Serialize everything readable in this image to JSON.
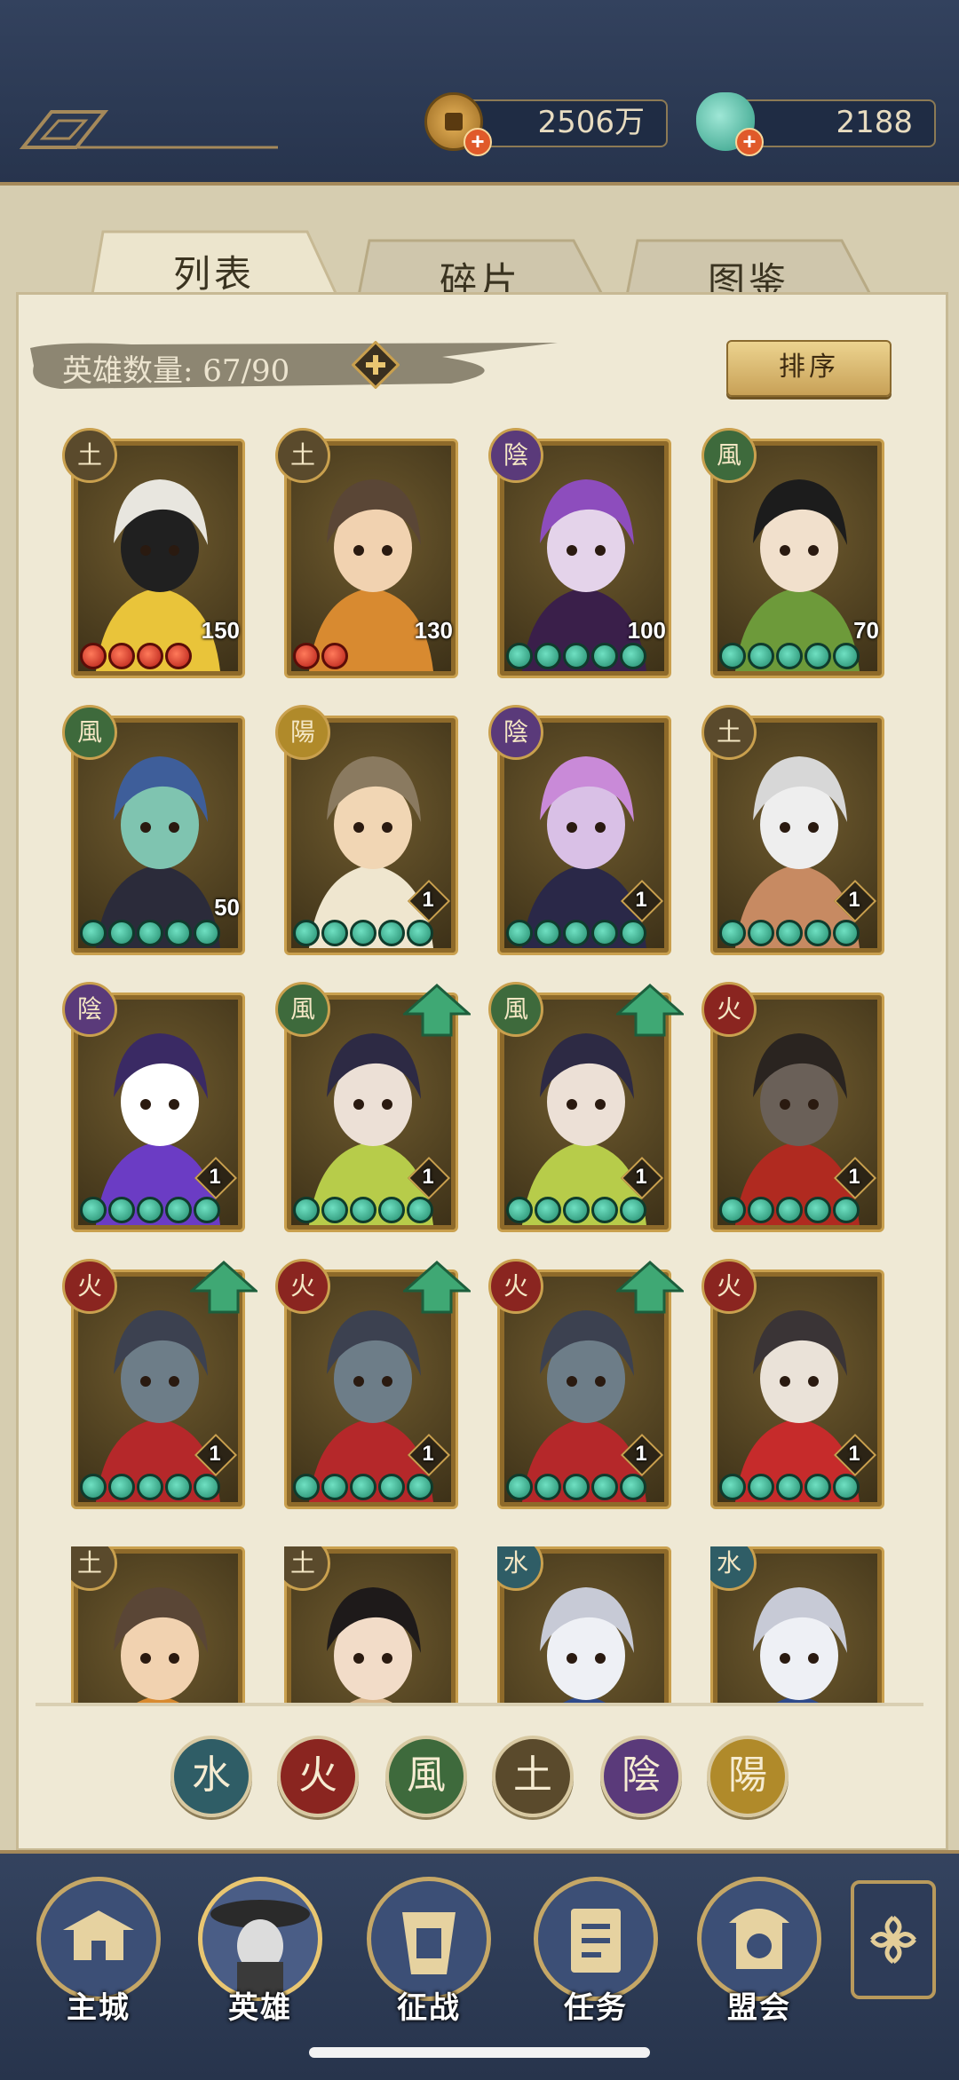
{
  "currency": {
    "coins": "2506万",
    "jade": "2188"
  },
  "tabs": [
    {
      "label": "列表"
    },
    {
      "label": "碎片"
    },
    {
      "label": "图鉴"
    }
  ],
  "hero_count": "英雄数量:  67/90",
  "sort_label": "排序",
  "element_colors": {
    "earth": "#5a4a2c",
    "yin": "#5a3a7a",
    "wind": "#3e6a3c",
    "yang": "#b08a2a",
    "fire": "#8a2520",
    "water": "#2f5d66"
  },
  "heroes": [
    {
      "element": "土",
      "level": "150",
      "stars": 4,
      "star_color": "red",
      "upgrade": false,
      "portrait": "white-hair-girl"
    },
    {
      "element": "土",
      "level": "130",
      "stars": 2,
      "star_color": "red",
      "upgrade": false,
      "portrait": "brown-hair-boy"
    },
    {
      "element": "陰",
      "level": "100",
      "stars": 5,
      "star_color": "green",
      "upgrade": false,
      "portrait": "purple-spider-lady"
    },
    {
      "element": "風",
      "level": "70",
      "stars": 5,
      "star_color": "green",
      "upgrade": false,
      "portrait": "black-hair-lady"
    },
    {
      "element": "風",
      "level": "50",
      "stars": 5,
      "star_color": "green",
      "upgrade": false,
      "portrait": "blue-hat-girl"
    },
    {
      "element": "陽",
      "level": "1",
      "stars": 5,
      "star_color": "green",
      "upgrade": false,
      "portrait": "cloak-youth"
    },
    {
      "element": "陰",
      "level": "1",
      "stars": 5,
      "star_color": "green",
      "upgrade": false,
      "portrait": "pink-hair-woman"
    },
    {
      "element": "土",
      "level": "1",
      "stars": 5,
      "star_color": "green",
      "upgrade": false,
      "portrait": "white-beard-old-man"
    },
    {
      "element": "陰",
      "level": "1",
      "stars": 5,
      "star_color": "green",
      "upgrade": false,
      "portrait": "masked-purple-ninja"
    },
    {
      "element": "風",
      "level": "1",
      "stars": 5,
      "star_color": "green",
      "upgrade": true,
      "portrait": "twin-tail-girl"
    },
    {
      "element": "風",
      "level": "1",
      "stars": 5,
      "star_color": "green",
      "upgrade": true,
      "portrait": "twin-tail-girl"
    },
    {
      "element": "火",
      "level": "1",
      "stars": 5,
      "star_color": "green",
      "upgrade": false,
      "portrait": "straw-hat-ronin"
    },
    {
      "element": "火",
      "level": "1",
      "stars": 5,
      "star_color": "green",
      "upgrade": true,
      "portrait": "long-beard-warrior"
    },
    {
      "element": "火",
      "level": "1",
      "stars": 5,
      "star_color": "green",
      "upgrade": true,
      "portrait": "long-beard-warrior"
    },
    {
      "element": "火",
      "level": "1",
      "stars": 5,
      "star_color": "green",
      "upgrade": true,
      "portrait": "long-beard-warrior"
    },
    {
      "element": "火",
      "level": "1",
      "stars": 5,
      "star_color": "green",
      "upgrade": false,
      "portrait": "red-armor-noble"
    },
    {
      "element": "土",
      "level": "",
      "stars": 0,
      "star_color": "green",
      "upgrade": false,
      "portrait": "brown-hair-boy"
    },
    {
      "element": "土",
      "level": "",
      "stars": 0,
      "star_color": "green",
      "upgrade": false,
      "portrait": "horned-girl"
    },
    {
      "element": "水",
      "level": "",
      "stars": 0,
      "star_color": "green",
      "upgrade": false,
      "portrait": "silver-hair-man"
    },
    {
      "element": "水",
      "level": "",
      "stars": 0,
      "star_color": "green",
      "upgrade": false,
      "portrait": "silver-hair-man"
    }
  ],
  "filters": [
    {
      "glyph": "水",
      "color": "#2f5d66"
    },
    {
      "glyph": "火",
      "color": "#8a2520"
    },
    {
      "glyph": "風",
      "color": "#3e6a3c"
    },
    {
      "glyph": "土",
      "color": "#5a4a2c"
    },
    {
      "glyph": "陰",
      "color": "#5a3a7a"
    },
    {
      "glyph": "陽",
      "color": "#b08a2a"
    }
  ],
  "nav": [
    {
      "label": "主城",
      "icon": "castle-icon"
    },
    {
      "label": "英雄",
      "icon": "hero-icon"
    },
    {
      "label": "征战",
      "icon": "battle-icon"
    },
    {
      "label": "任务",
      "icon": "quest-icon"
    },
    {
      "label": "盟会",
      "icon": "guild-icon"
    }
  ]
}
